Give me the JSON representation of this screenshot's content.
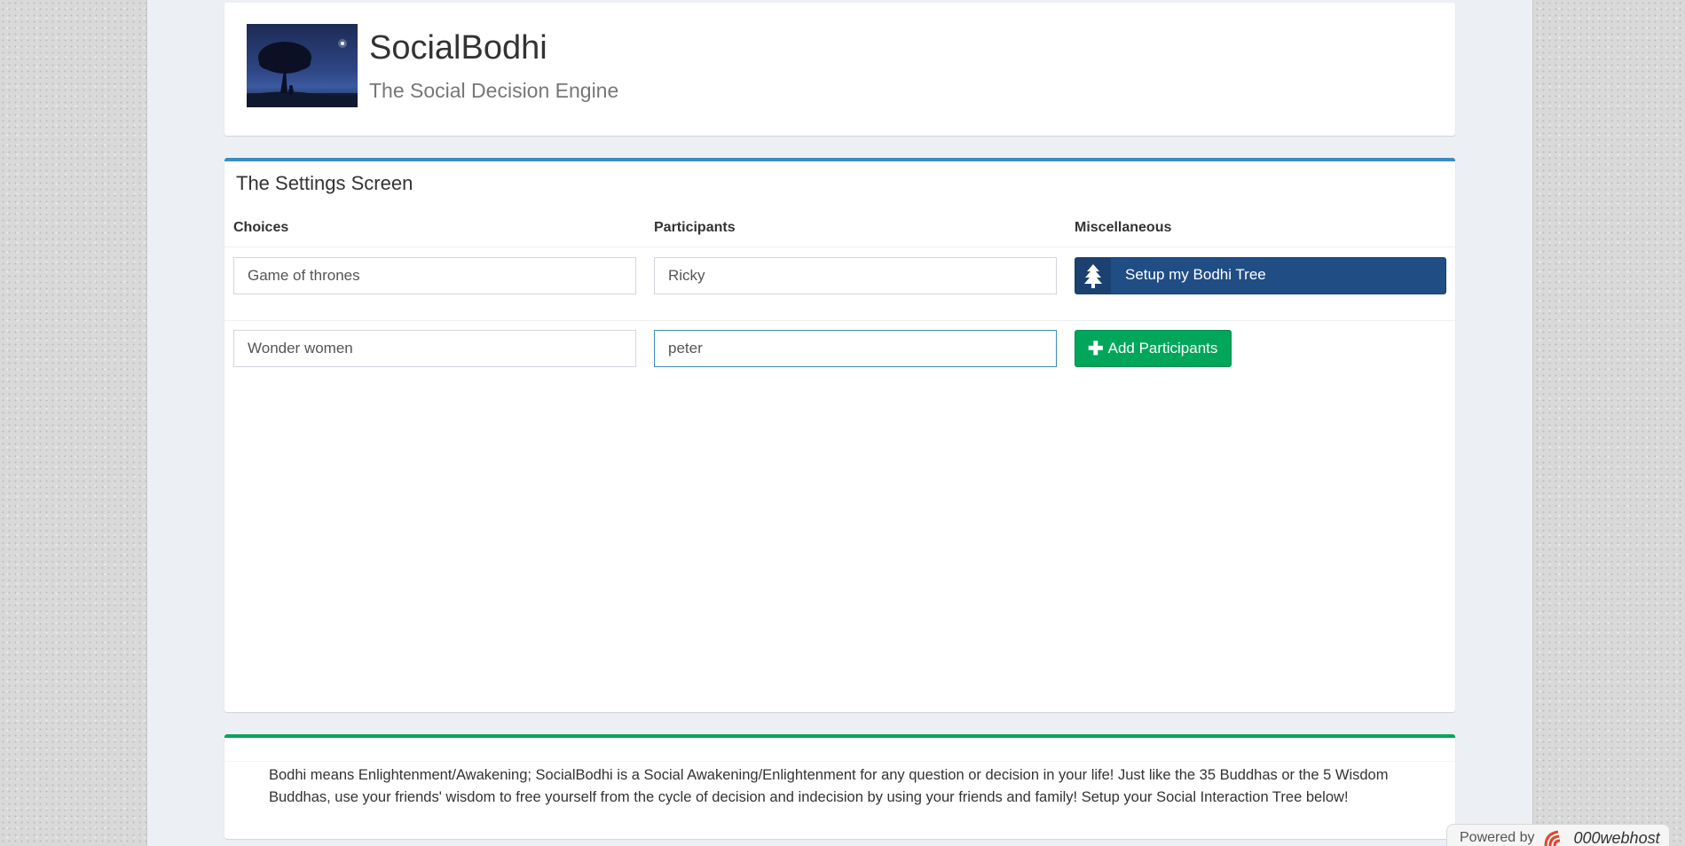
{
  "header": {
    "title": "SocialBodhi",
    "subtitle": "The Social Decision Engine",
    "logo_icon": "bodhi-tree-logo"
  },
  "settings": {
    "title": "The Settings Screen",
    "columns": {
      "choices": "Choices",
      "participants": "Participants",
      "misc": "Miscellaneous"
    },
    "choices": [
      "Game of thrones",
      "Wonder women"
    ],
    "participants": [
      "Ricky",
      "peter"
    ],
    "setup_button": {
      "label": "Setup my Bodhi Tree",
      "icon": "tree-icon"
    },
    "add_button": {
      "label": "Add Participants",
      "icon": "plus-icon"
    }
  },
  "info": {
    "text": "Bodhi means Enlightenment/Awakening; SocialBodhi is a Social Awakening/Enlightenment for any question or decision in your life! Just like the 35 Buddhas or the 5 Wisdom Buddhas, use your friends' wisdom to free yourself from the cycle of decision and indecision by using your friends and family! Setup your Social Interaction Tree below!"
  },
  "footer": {
    "powered_label": "Powered by",
    "brand": "000webhost"
  },
  "colors": {
    "primary": "#3c8dbc",
    "bodhi_button": "#204d84",
    "success": "#00a65a"
  }
}
